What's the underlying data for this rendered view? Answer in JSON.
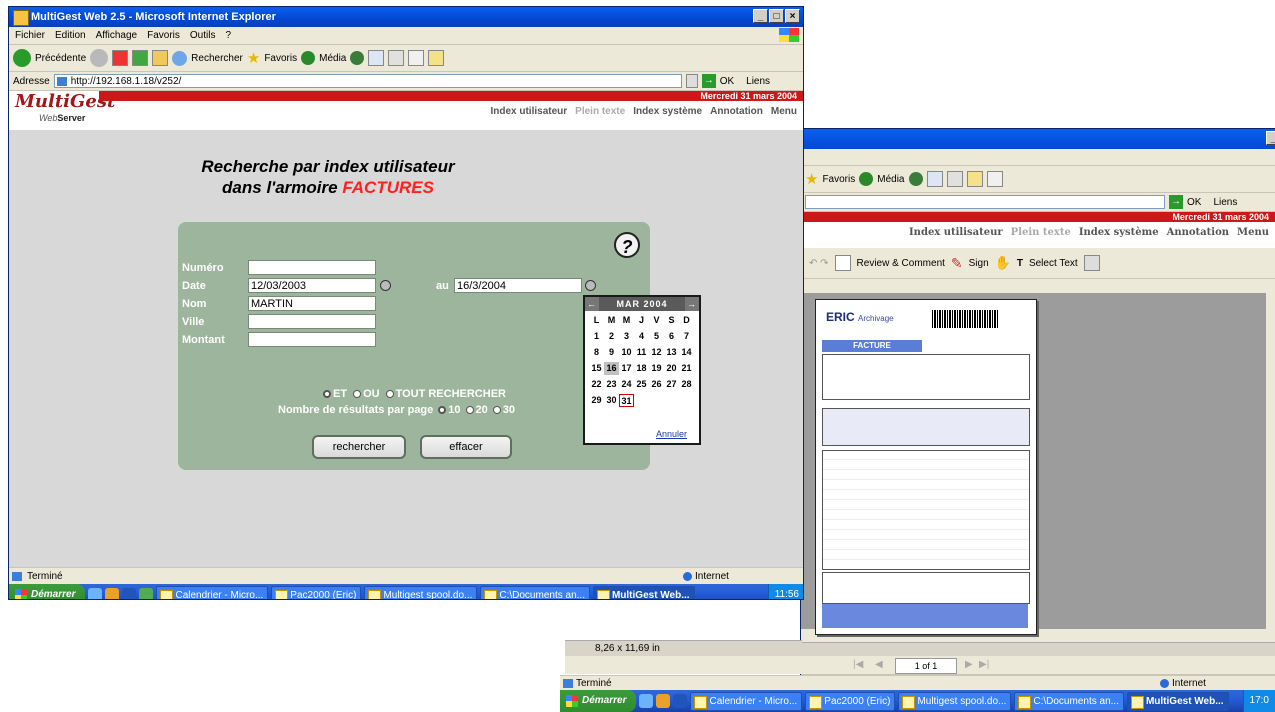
{
  "colors": {
    "xp_blue": "#0348d2",
    "mg_red": "#cc1818",
    "form_green": "#9db59c",
    "form_label": "#ffffff",
    "factures": "#ff2020"
  },
  "win1": {
    "title": "MultiGest Web 2.5 - Microsoft Internet Explorer",
    "menu": [
      "Fichier",
      "Edition",
      "Affichage",
      "Favoris",
      "Outils",
      "?"
    ],
    "toolbar": {
      "back": "Précédente",
      "search": "Rechercher",
      "favorites": "Favoris",
      "media": "Média"
    },
    "address": {
      "label": "Adresse",
      "url": "http://192.168.1.18/v252/",
      "go": "OK",
      "links": "Liens"
    },
    "mg": {
      "logo": "MultiGest",
      "sub_web": "Web",
      "sub_server": "Server",
      "date": "Mercredi 31 mars 2004",
      "nav": [
        "Index utilisateur",
        "Plein texte",
        "Index système",
        "Annotation",
        "Menu"
      ]
    },
    "heading_line1": "Recherche par index utilisateur",
    "heading_line2_prefix": "dans l'armoire ",
    "heading_line2_highlight": "FACTURES",
    "help_icon": "?",
    "fields": [
      {
        "label": "Numéro",
        "value": ""
      },
      {
        "label": "Date",
        "value": "12/03/2003"
      },
      {
        "label": "Nom",
        "value": "MARTIN"
      },
      {
        "label": "Ville",
        "value": ""
      },
      {
        "label": "Montant",
        "value": ""
      }
    ],
    "date_to_label": "au",
    "date_to_value": "16/3/2004",
    "search_modes": [
      "ET",
      "OU",
      "TOUT RECHERCHER"
    ],
    "results_label": "Nombre de résultats par page",
    "results_options": [
      "10",
      "20",
      "30"
    ],
    "btn_search": "rechercher",
    "btn_clear": "effacer",
    "calendar": {
      "month": "MAR 2004",
      "prev": "←",
      "next": "→",
      "weekdays": [
        "L",
        "M",
        "M",
        "J",
        "V",
        "S",
        "D"
      ],
      "days": [
        "1",
        "2",
        "3",
        "4",
        "5",
        "6",
        "7",
        "8",
        "9",
        "10",
        "11",
        "12",
        "13",
        "14",
        "15",
        "16",
        "17",
        "18",
        "19",
        "20",
        "21",
        "22",
        "23",
        "24",
        "25",
        "26",
        "27",
        "28",
        "29",
        "30",
        "31"
      ],
      "cancel": "Annuler"
    },
    "status": "Terminé",
    "zone": "Internet"
  },
  "taskbar": {
    "start": "Démarrer",
    "tasks": [
      "Calendrier - Micro...",
      "Pac2000 (Eric)",
      "Multigest spool.do...",
      "C:\\Documents an...",
      "MultiGest Web..."
    ],
    "clock1": "11:56",
    "clock2": "17:0"
  },
  "win2": {
    "toolbar": {
      "favorites": "Favoris",
      "media": "Média"
    },
    "address": {
      "go": "OK",
      "links": "Liens"
    },
    "mg": {
      "date": "Mercredi 31 mars 2004",
      "nav": [
        "Index utilisateur",
        "Plein texte",
        "Index système",
        "Annotation",
        "Menu"
      ]
    },
    "pdf_toolbar": {
      "review": "Review & Comment",
      "sign": "Sign",
      "select": "Select Text"
    },
    "doc": {
      "brand": "ERIC",
      "brand2": "Archivage",
      "type": "FACTURE"
    },
    "page_size": "8,26 x 11,69 in",
    "page_nav": "1 of 1",
    "status": "Terminé",
    "zone": "Internet"
  }
}
